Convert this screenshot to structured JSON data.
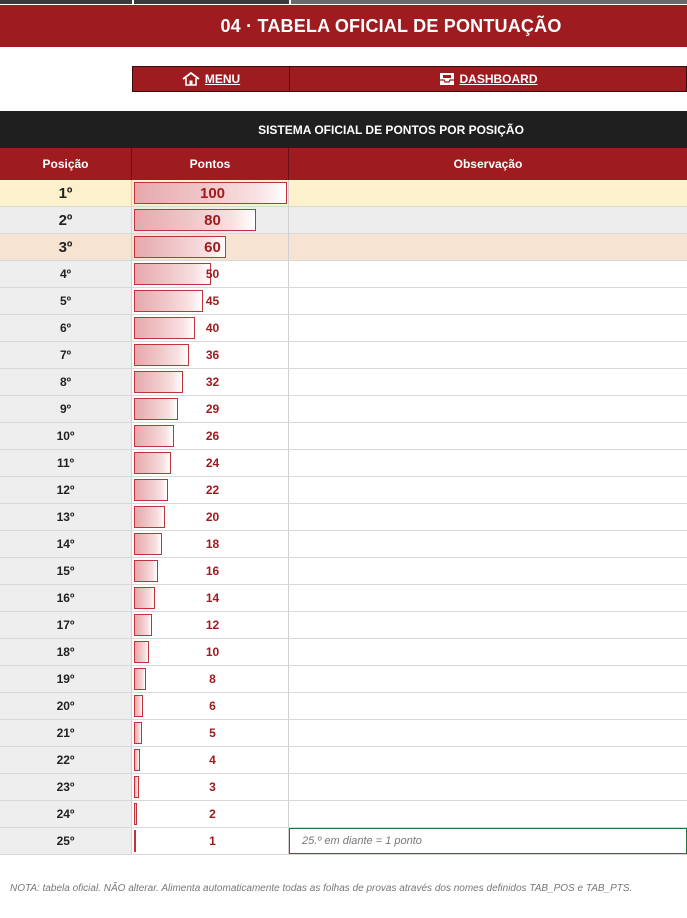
{
  "title": "04 · TABELA OFICIAL DE PONTUAÇÃO",
  "nav": {
    "menu_label": "MENU",
    "menu_icon": "home-icon",
    "dashboard_label": "DASHBOARD",
    "dashboard_icon": "inbox-icon"
  },
  "section_title": "SISTEMA OFICIAL DE PONTOS POR POSIÇÃO",
  "table": {
    "headers": [
      "Posição",
      "Pontos",
      "Observação"
    ],
    "max_points": 100,
    "rows": [
      {
        "pos": "1º",
        "pts": 100,
        "obs": ""
      },
      {
        "pos": "2º",
        "pts": 80,
        "obs": ""
      },
      {
        "pos": "3º",
        "pts": 60,
        "obs": ""
      },
      {
        "pos": "4º",
        "pts": 50,
        "obs": ""
      },
      {
        "pos": "5º",
        "pts": 45,
        "obs": ""
      },
      {
        "pos": "6º",
        "pts": 40,
        "obs": ""
      },
      {
        "pos": "7º",
        "pts": 36,
        "obs": ""
      },
      {
        "pos": "8º",
        "pts": 32,
        "obs": ""
      },
      {
        "pos": "9º",
        "pts": 29,
        "obs": ""
      },
      {
        "pos": "10º",
        "pts": 26,
        "obs": ""
      },
      {
        "pos": "11º",
        "pts": 24,
        "obs": ""
      },
      {
        "pos": "12º",
        "pts": 22,
        "obs": ""
      },
      {
        "pos": "13º",
        "pts": 20,
        "obs": ""
      },
      {
        "pos": "14º",
        "pts": 18,
        "obs": ""
      },
      {
        "pos": "15º",
        "pts": 16,
        "obs": ""
      },
      {
        "pos": "16º",
        "pts": 14,
        "obs": ""
      },
      {
        "pos": "17º",
        "pts": 12,
        "obs": ""
      },
      {
        "pos": "18º",
        "pts": 10,
        "obs": ""
      },
      {
        "pos": "19º",
        "pts": 8,
        "obs": ""
      },
      {
        "pos": "20º",
        "pts": 6,
        "obs": ""
      },
      {
        "pos": "21º",
        "pts": 5,
        "obs": ""
      },
      {
        "pos": "22º",
        "pts": 4,
        "obs": ""
      },
      {
        "pos": "23º",
        "pts": 3,
        "obs": ""
      },
      {
        "pos": "24º",
        "pts": 2,
        "obs": ""
      },
      {
        "pos": "25º",
        "pts": 1,
        "obs": "25.º em diante = 1 ponto"
      }
    ]
  },
  "footnote": "NOTA: tabela oficial. NÃO alterar. Alimenta automaticamente todas as folhas de provas através dos nomes definidos TAB_POS e TAB_PTS.",
  "colors": {
    "brand_red": "#9e1b20",
    "dark_bar": "#1f1f1f",
    "first_place": "#fdf0cc",
    "second_place": "#ededed",
    "third_place": "#f7e3d2",
    "selected_cell_border": "#217346"
  }
}
